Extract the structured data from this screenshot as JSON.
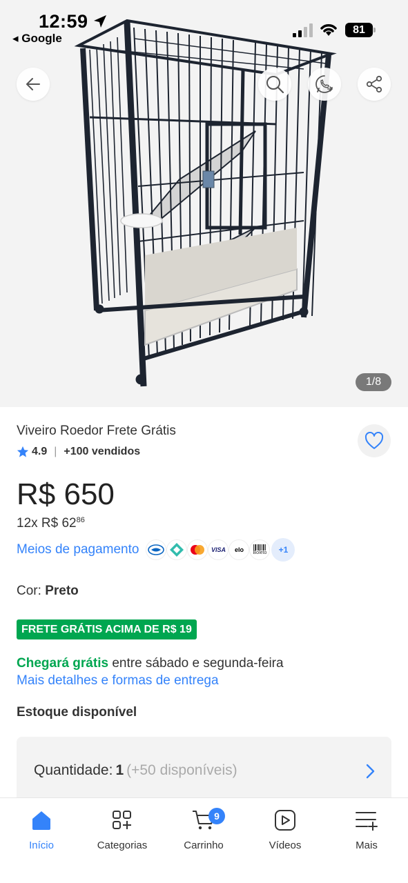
{
  "status_bar": {
    "time": "12:59",
    "back_app": "◂ Google",
    "battery": "81"
  },
  "hero": {
    "image_counter": "1/8",
    "image_alt": "product-cage-photo"
  },
  "header_actions": {
    "back_icon": "arrow-left-icon",
    "search_icon": "search-icon",
    "whatsapp_icon": "whatsapp-icon",
    "share_icon": "share-icon"
  },
  "product": {
    "title": "Viveiro Roedor Frete Grátis",
    "rating": "4.9",
    "sold": "+100 vendidos",
    "price": "R$ 650",
    "installments_prefix": "12x R$ 62",
    "installments_cents": "86",
    "payment_link": "Meios de pagamento",
    "payment_methods": [
      "mercadopago",
      "pix",
      "mastercard",
      "VISA",
      "elo",
      "Boleto"
    ],
    "payment_more": "+1",
    "color_label": "Cor: ",
    "color_value": "Preto",
    "shipping_badge": "FRETE GRÁTIS ACIMA DE R$ 19",
    "delivery_free": "Chegará grátis",
    "delivery_rest": " entre sábado e segunda-feira",
    "delivery_more": "Mais detalhes e formas de entrega",
    "stock": "Estoque disponível",
    "quantity_label": "Quantidade:",
    "quantity_value": "1",
    "quantity_available": "(+50 disponíveis)"
  },
  "bottom_nav": {
    "items": [
      {
        "label": "Início",
        "icon": "home-icon",
        "active": true
      },
      {
        "label": "Categorias",
        "icon": "categories-icon"
      },
      {
        "label": "Carrinho",
        "icon": "cart-icon",
        "badge": "9"
      },
      {
        "label": "Vídeos",
        "icon": "video-icon"
      },
      {
        "label": "Mais",
        "icon": "more-list-icon"
      }
    ]
  },
  "colors": {
    "accent_blue": "#3483fa",
    "green": "#00a650",
    "hero_bg": "#f3f3f3"
  }
}
